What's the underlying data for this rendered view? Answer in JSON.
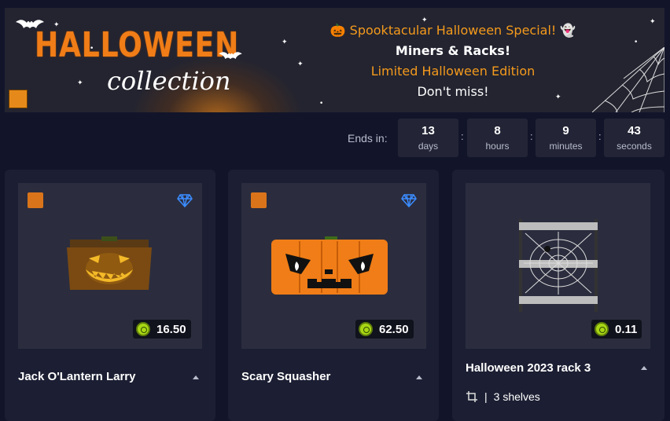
{
  "banner": {
    "title_big": "HALLOWEEN",
    "title_small": "collection",
    "promo_line1": "🎃 Spooktacular Halloween Special! 👻",
    "promo_line2": "Miners & Racks!",
    "promo_line3": "Limited Halloween Edition",
    "promo_line4": "Don't miss!"
  },
  "countdown": {
    "label": "Ends in:",
    "items": [
      {
        "value": "13",
        "unit": "days"
      },
      {
        "value": "8",
        "unit": "hours"
      },
      {
        "value": "9",
        "unit": "minutes"
      },
      {
        "value": "43",
        "unit": "seconds"
      }
    ],
    "separator": ":"
  },
  "cards": [
    {
      "name": "Jack O'Lantern Larry",
      "price": "16.50",
      "icon": "pumpkin-crate-icon",
      "badge": "diamond-icon"
    },
    {
      "name": "Scary Squasher",
      "price": "62.50",
      "icon": "pumpkin-crate-icon",
      "badge": "diamond-icon"
    },
    {
      "name": "Halloween 2023 rack 3",
      "price": "0.11",
      "shelves": "3 shelves",
      "shelves_sep": "|"
    }
  ],
  "colors": {
    "accent_orange": "#f07d17",
    "coin_green": "#a9d615",
    "gem_blue": "#3b8cff"
  }
}
